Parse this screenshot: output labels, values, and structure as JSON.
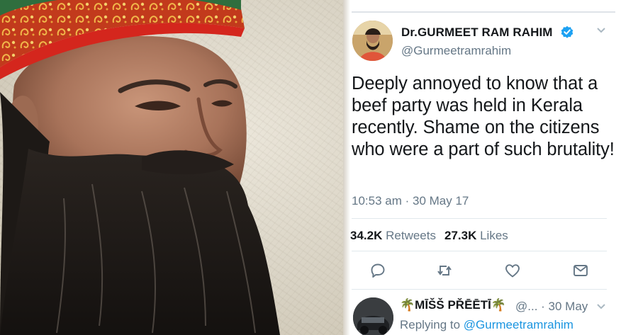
{
  "tweet": {
    "display_name": "Dr.GURMEET RAM RAHIM",
    "handle": "@Gurmeetramrahim",
    "text": "Deeply annoyed to know that a beef party was held in Kerala recently. Shame on the citizens who were a part of such brutality!",
    "timestamp": "10:53 am · 30 May 17",
    "retweets_count": "34.2K",
    "retweets_label": "Retweets",
    "likes_count": "27.3K",
    "likes_label": "Likes",
    "verified_color": "#1da1f2",
    "icons": [
      "reply-icon",
      "retweet-icon",
      "like-icon",
      "message-icon"
    ]
  },
  "reply": {
    "display_name": "🌴MĪŠŠ PŘĒĒTĪ🌴",
    "meta": "@... · 30 May",
    "replying_prefix": "Replying to",
    "replying_mention": "@Gurmeetramrahim"
  },
  "colors": {
    "text": "#14171a",
    "secondary": "#657786",
    "link": "#1b95e0",
    "turban_red": "#d4261d"
  }
}
